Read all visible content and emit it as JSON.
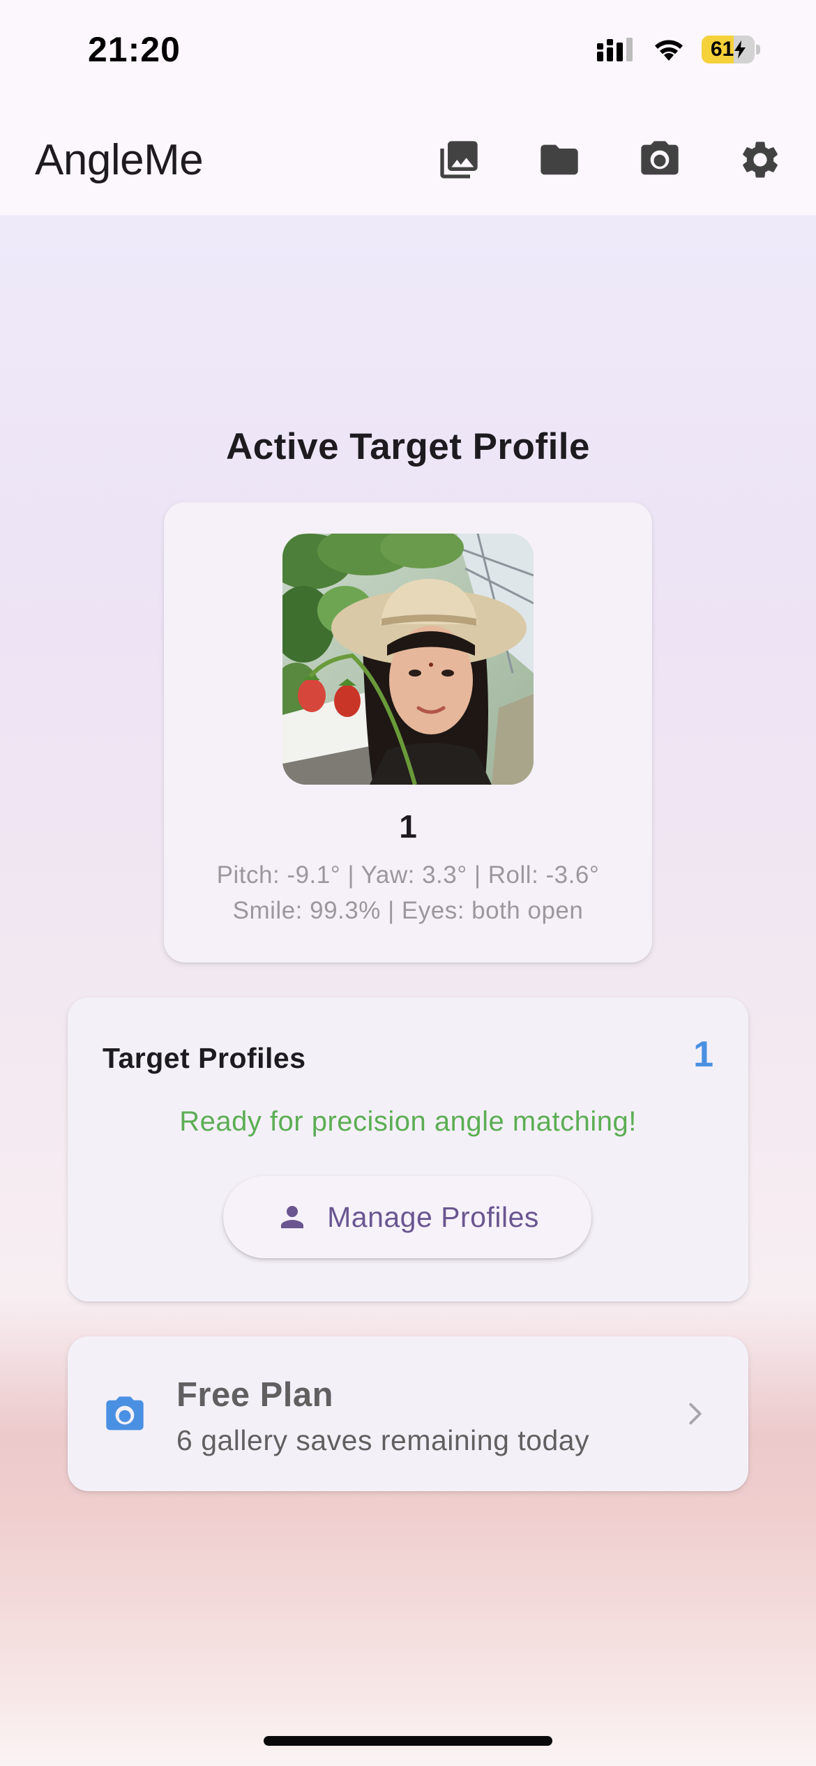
{
  "status_bar": {
    "time": "21:20",
    "battery_percent": "61",
    "battery_level": 0.61,
    "icons": [
      "cellular-signal-icon",
      "wifi-icon",
      "battery-charging-icon"
    ]
  },
  "app_bar": {
    "title": "AngleMe",
    "actions": [
      {
        "name": "gallery",
        "icon": "photo-library-icon"
      },
      {
        "name": "folder",
        "icon": "folder-icon"
      },
      {
        "name": "camera",
        "icon": "camera-icon"
      },
      {
        "name": "settings",
        "icon": "gear-icon"
      }
    ]
  },
  "main": {
    "heading": "Active Target Profile",
    "active_profile": {
      "name": "1",
      "angles": "Pitch: -9.1° | Yaw: 3.3° | Roll: -3.6°",
      "expression": "Smile: 99.3% | Eyes: both open"
    },
    "targets": {
      "title": "Target Profiles",
      "count": "1",
      "status": "Ready for precision angle matching!",
      "manage_label": "Manage Profiles"
    },
    "plan": {
      "title": "Free Plan",
      "subtitle": "6 gallery saves remaining today"
    }
  },
  "colors": {
    "accent_blue": "#4a90e2",
    "status_green": "#5cae54",
    "button_purple": "#6a5590",
    "battery_yellow": "#f5d13a"
  }
}
